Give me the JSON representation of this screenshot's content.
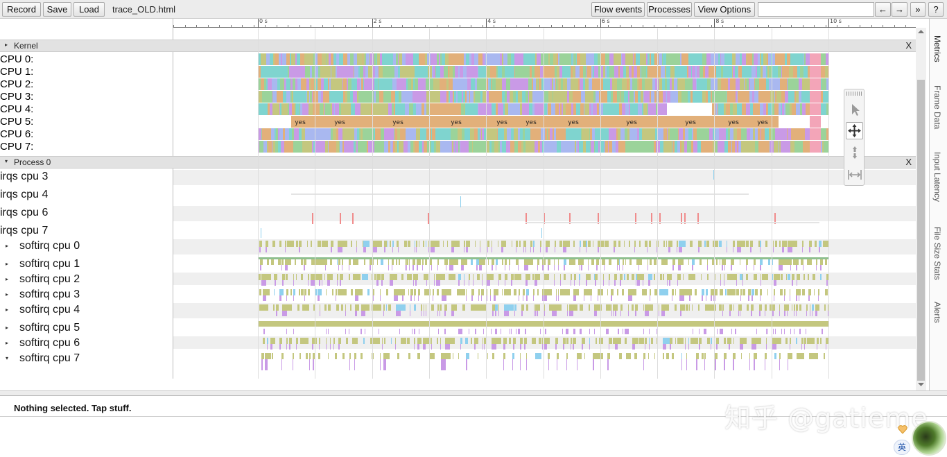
{
  "toolbar": {
    "record": "Record",
    "save": "Save",
    "load": "Load",
    "filename": "trace_OLD.html",
    "flow_events": "Flow events",
    "processes": "Processes",
    "view_options": "View Options",
    "search_value": "",
    "prev": "←",
    "next": "→",
    "more": "»",
    "help": "?"
  },
  "ruler": {
    "labels": [
      "0 s",
      "2 s",
      "4 s",
      "6 s",
      "8 s",
      "10 s"
    ]
  },
  "kernel": {
    "title": "Kernel",
    "close": "X",
    "cpus": [
      "CPU 0:",
      "CPU 1:",
      "CPU 2:",
      "CPU 3:",
      "CPU 4:",
      "CPU 5:",
      "CPU 6:",
      "CPU 7:"
    ],
    "slice_label": "yes"
  },
  "process": {
    "title": "Process 0",
    "close": "X",
    "rows": [
      {
        "label": "irqs cpu 3",
        "expandable": false
      },
      {
        "label": "irqs cpu 4",
        "expandable": false
      },
      {
        "label": "irqs cpu 6",
        "expandable": false
      },
      {
        "label": "irqs cpu 7",
        "expandable": false
      },
      {
        "label": "softirq cpu 0",
        "expandable": true
      },
      {
        "label": "softirq cpu 1",
        "expandable": true
      },
      {
        "label": "softirq cpu 2",
        "expandable": true
      },
      {
        "label": "softirq cpu 3",
        "expandable": true
      },
      {
        "label": "softirq cpu 4",
        "expandable": true
      },
      {
        "label": "softirq cpu 5",
        "expandable": true
      },
      {
        "label": "softirq cpu 6",
        "expandable": true
      },
      {
        "label": "softirq cpu 7",
        "expandable": true
      }
    ]
  },
  "side_tabs": [
    "Metrics",
    "Frame Data",
    "Input Latency",
    "File Size Stats",
    "Alerts"
  ],
  "analysis": {
    "status": "Nothing selected. Tap stuff."
  },
  "watermark": "知乎 @gatieme",
  "ime": "英",
  "colors": {
    "slice_orange": "#e2b07a",
    "slice_green": "#9bd39a",
    "slice_blue": "#a9b8f0",
    "slice_teal": "#7fd4cf",
    "slice_olive": "#c4c77f",
    "slice_purple": "#c99ae6",
    "slice_red": "#f08e8e",
    "slice_pink": "#f3a5b8",
    "irq_red": "#f08c8c",
    "irq_blue": "#8fd0ee"
  }
}
